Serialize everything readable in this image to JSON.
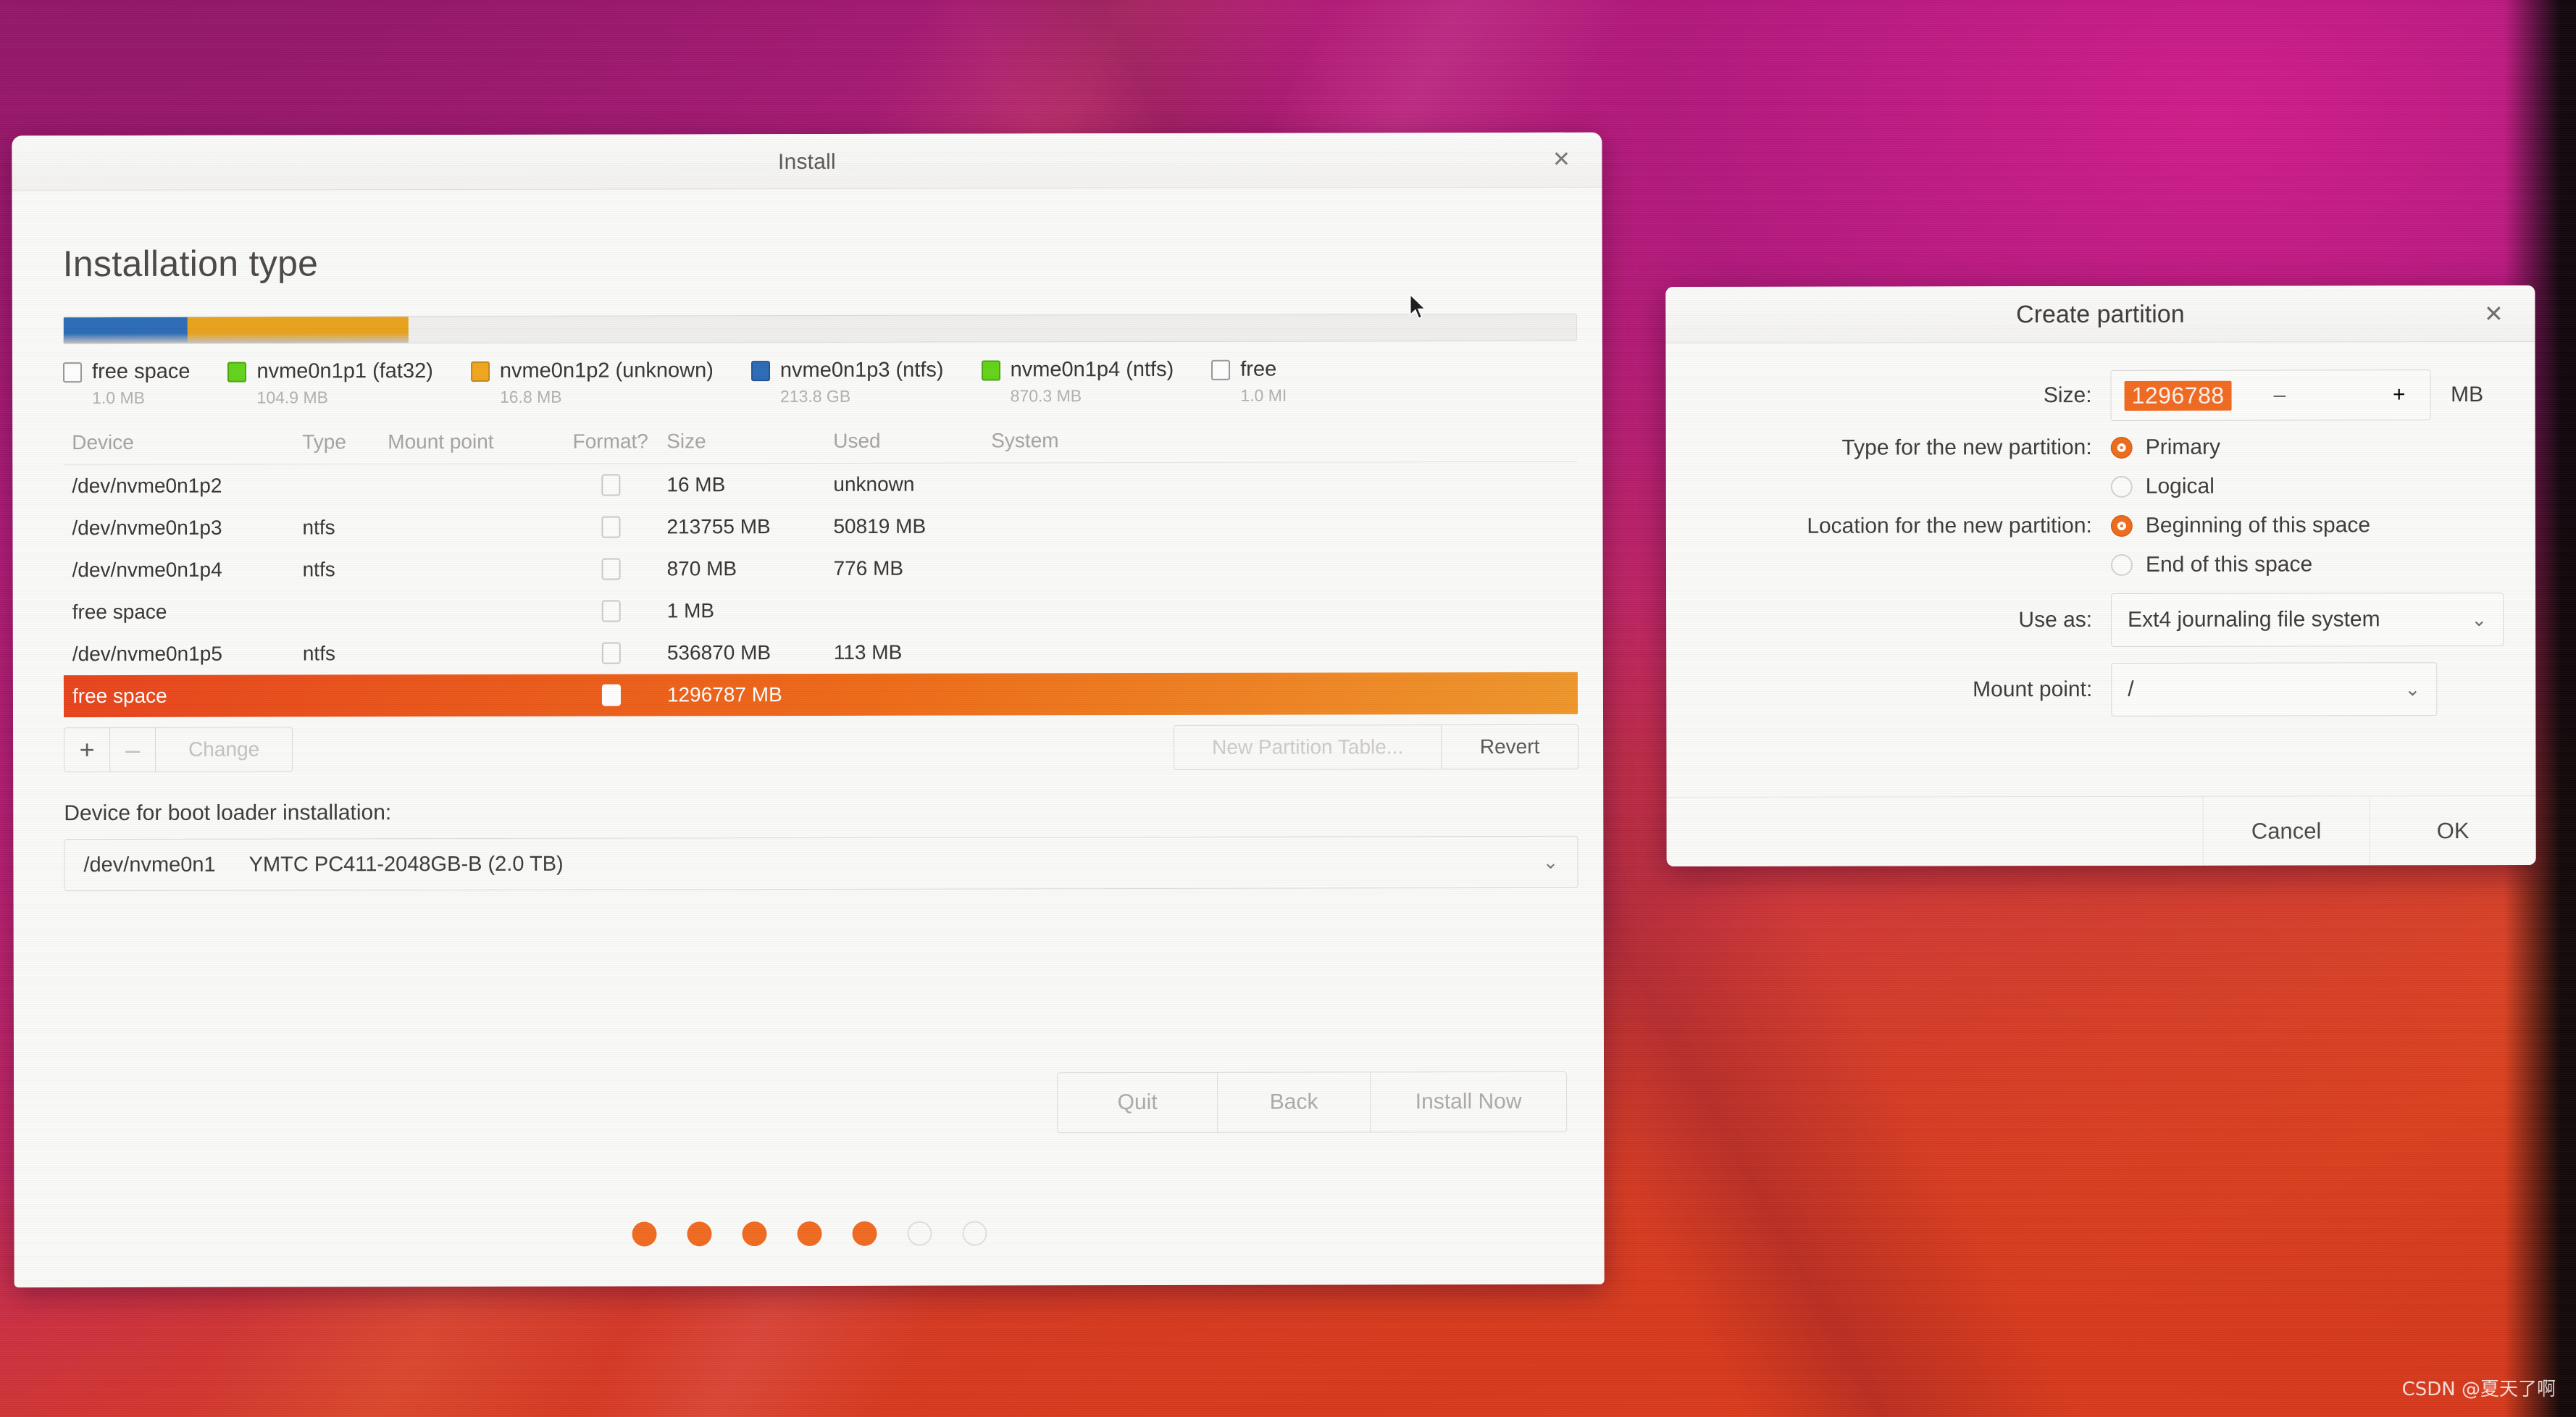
{
  "desktop": {
    "watermark": "CSDN @夏天了啊"
  },
  "install_window": {
    "title": "Install",
    "close_icon": "✕",
    "page_title": "Installation type",
    "partition_bar": [
      {
        "name": "free space",
        "color": "#2b6cb8",
        "width_pct": 8.2
      },
      {
        "name": "nvme0n1p1",
        "color": "#e9a21b",
        "width_pct": 14.6
      },
      {
        "name": "rest",
        "color": "#f2f0ee",
        "width_pct": 77.2
      }
    ],
    "legend": [
      {
        "label": "free space",
        "size": "1.0 MB",
        "color": "#ffffff",
        "border": "#9a9794",
        "gap": 0
      },
      {
        "label": "nvme0n1p1 (fat32)",
        "size": "104.9 MB",
        "color": "#63d419",
        "border": "#4da50f",
        "gap": 52
      },
      {
        "label": "nvme0n1p2 (unknown)",
        "size": "16.8 MB",
        "color": "#f0a71c",
        "border": "#c98612",
        "gap": 52
      },
      {
        "label": "nvme0n1p3 (ntfs)",
        "size": "213.8 GB",
        "color": "#2b6cb8",
        "border": "#215493",
        "gap": 52
      },
      {
        "label": "nvme0n1p4 (ntfs)",
        "size": "870.3 MB",
        "color": "#63d419",
        "border": "#4da50f",
        "gap": 52
      },
      {
        "label": "free",
        "size": "1.0 MI",
        "color": "#ffffff",
        "border": "#9a9794",
        "gap": 52
      }
    ],
    "table": {
      "headers": [
        "Device",
        "Type",
        "Mount point",
        "Format?",
        "Size",
        "Used",
        "System"
      ],
      "rows": [
        {
          "device": "/dev/nvme0n1p2",
          "type": "",
          "mount": "",
          "format": true,
          "size": "16 MB",
          "used": "unknown",
          "system": "",
          "selected": false
        },
        {
          "device": "/dev/nvme0n1p3",
          "type": "ntfs",
          "mount": "",
          "format": true,
          "size": "213755 MB",
          "used": "50819 MB",
          "system": "",
          "selected": false
        },
        {
          "device": "/dev/nvme0n1p4",
          "type": "ntfs",
          "mount": "",
          "format": true,
          "size": "870 MB",
          "used": "776 MB",
          "system": "",
          "selected": false
        },
        {
          "device": "free space",
          "type": "",
          "mount": "",
          "format": true,
          "size": "1 MB",
          "used": "",
          "system": "",
          "selected": false
        },
        {
          "device": "/dev/nvme0n1p5",
          "type": "ntfs",
          "mount": "",
          "format": true,
          "size": "536870 MB",
          "used": "113 MB",
          "system": "",
          "selected": false
        },
        {
          "device": "free space",
          "type": "",
          "mount": "",
          "format": true,
          "size": "1296787 MB",
          "used": "",
          "system": "",
          "selected": true
        }
      ]
    },
    "toolbar": {
      "add_label": "+",
      "remove_label": "–",
      "change_label": "Change",
      "new_partition_table_label": "New Partition Table...",
      "revert_label": "Revert"
    },
    "bootloader": {
      "label": "Device for boot loader installation:",
      "device": "/dev/nvme0n1",
      "description": "YMTC PC411-2048GB-B (2.0 TB)",
      "chevron": "⌄"
    },
    "nav": {
      "quit_label": "Quit",
      "back_label": "Back",
      "install_label": "Install Now"
    },
    "steps": {
      "total": 7,
      "completed": 5
    }
  },
  "create_partition_dialog": {
    "title": "Create partition",
    "close_icon": "✕",
    "size": {
      "label": "Size:",
      "value": "1296788",
      "unit": "MB",
      "minus_icon": "–",
      "plus_icon": "+"
    },
    "type": {
      "label": "Type for the new partition:",
      "options": [
        {
          "label": "Primary",
          "checked": true
        },
        {
          "label": "Logical",
          "checked": false
        }
      ]
    },
    "location": {
      "label": "Location for the new partition:",
      "options": [
        {
          "label": "Beginning of this space",
          "checked": true
        },
        {
          "label": "End of this space",
          "checked": false
        }
      ]
    },
    "use_as": {
      "label": "Use as:",
      "value": "Ext4 journaling file system",
      "chevron": "⌄"
    },
    "mount_point": {
      "label": "Mount point:",
      "value": "/",
      "chevron": "⌄"
    },
    "cancel_label": "Cancel",
    "ok_label": "OK"
  },
  "colors": {
    "accent_orange": "#ef6c1a",
    "selection_orange": "#e8431b",
    "legend_blue": "#2b6cb8",
    "legend_green": "#63d419",
    "legend_amber": "#f0a71c"
  }
}
